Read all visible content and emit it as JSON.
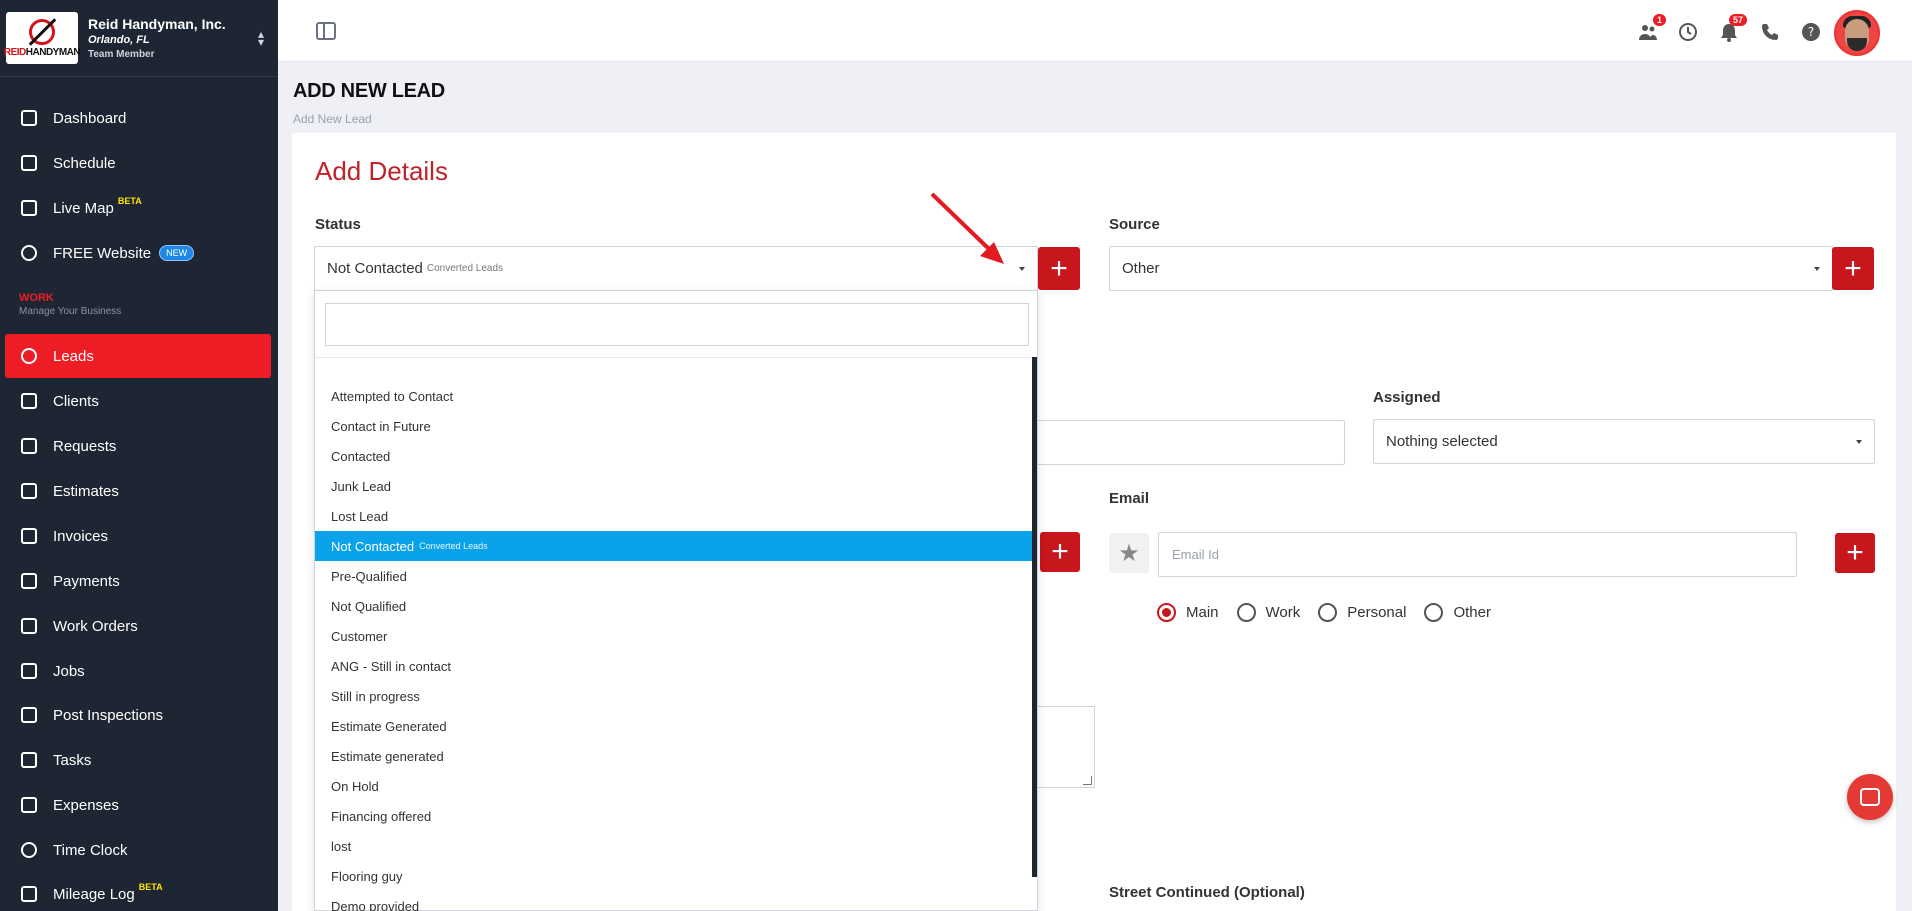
{
  "sidebar": {
    "company_name": "Reid Handyman, Inc.",
    "company_location": "Orlando, FL",
    "company_role": "Team Member",
    "logo_text_red": "REID",
    "logo_text_black": "HANDYMAN",
    "items": [
      {
        "label": "Dashboard",
        "icon": "dashboard-icon"
      },
      {
        "label": "Schedule",
        "icon": "calendar-icon"
      },
      {
        "label": "Live Map",
        "icon": "map-icon",
        "sup": "BETA"
      },
      {
        "label": "FREE Website",
        "icon": "globe-icon",
        "badge": "NEW"
      },
      {
        "label": "Leads",
        "icon": "leads-icon"
      },
      {
        "label": "Clients",
        "icon": "handshake-icon"
      },
      {
        "label": "Requests",
        "icon": "requests-icon"
      },
      {
        "label": "Estimates",
        "icon": "calculator-icon"
      },
      {
        "label": "Invoices",
        "icon": "invoice-icon"
      },
      {
        "label": "Payments",
        "icon": "payments-icon"
      },
      {
        "label": "Work Orders",
        "icon": "work-orders-icon"
      },
      {
        "label": "Jobs",
        "icon": "briefcase-icon"
      },
      {
        "label": "Post Inspections",
        "icon": "inspection-icon"
      },
      {
        "label": "Tasks",
        "icon": "clipboard-icon"
      },
      {
        "label": "Expenses",
        "icon": "wallet-icon"
      },
      {
        "label": "Time Clock",
        "icon": "clock-icon"
      },
      {
        "label": "Mileage Log",
        "icon": "mileage-icon",
        "sup": "BETA"
      }
    ],
    "section_title": "WORK",
    "section_subtitle": "Manage Your Business"
  },
  "topbar": {
    "team_badge": "1",
    "notification_badge": "57"
  },
  "page": {
    "title": "ADD NEW LEAD",
    "breadcrumb": "Add New Lead",
    "card_title": "Add Details"
  },
  "form": {
    "status_label": "Status",
    "status_value": "Not Contacted",
    "status_note": "Converted Leads",
    "source_label": "Source",
    "source_value": "Other",
    "assigned_label": "Assigned",
    "assigned_value": "Nothing selected",
    "email_label": "Email",
    "email_placeholder": "Email Id",
    "email_types": [
      "Main",
      "Work",
      "Personal",
      "Other"
    ],
    "street_continued_label": "Street Continued (Optional)"
  },
  "dropdown": {
    "options": [
      {
        "label": "Attempted to Contact"
      },
      {
        "label": "Contact in Future"
      },
      {
        "label": "Contacted"
      },
      {
        "label": "Junk Lead"
      },
      {
        "label": "Lost Lead"
      },
      {
        "label": "Not Contacted",
        "note": "Converted Leads",
        "selected": true
      },
      {
        "label": "Pre-Qualified"
      },
      {
        "label": "Not Qualified"
      },
      {
        "label": "Customer"
      },
      {
        "label": "ANG - Still in contact"
      },
      {
        "label": "Still in progress"
      },
      {
        "label": "Estimate Generated"
      },
      {
        "label": "Estimate generated"
      },
      {
        "label": "On Hold"
      },
      {
        "label": "Financing offered"
      },
      {
        "label": "lost"
      },
      {
        "label": "Flooring guy"
      },
      {
        "label": "Demo provided"
      }
    ]
  },
  "colors": {
    "brand_red": "#c8161d",
    "sidebar_bg": "#1f2633",
    "selected_blue": "#0aa2e8"
  }
}
